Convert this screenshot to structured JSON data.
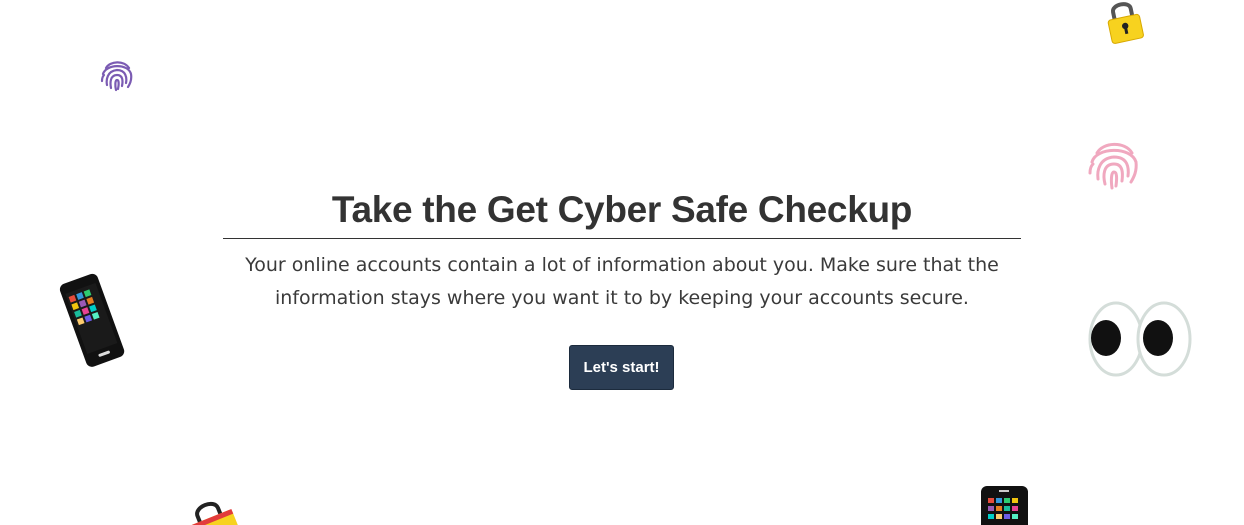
{
  "hero": {
    "title": "Take the Get Cyber Safe Checkup",
    "description": "Your online accounts contain a lot of information about you. Make sure that the information stays where you want it to by keeping your accounts secure.",
    "cta_label": "Let's start!"
  },
  "decorations": [
    "fingerprint-icon",
    "padlock-icon",
    "mobile-phone-icon",
    "eyes-icon"
  ],
  "colors": {
    "background": "#ffffff",
    "text": "#333333",
    "button": "#2c3e55",
    "button_text": "#ffffff",
    "fingerprint_purple": "#7b5bb3",
    "fingerprint_pink": "#f0a8bf",
    "lock_yellow": "#f7d21f",
    "lock_red": "#e23b3b"
  }
}
